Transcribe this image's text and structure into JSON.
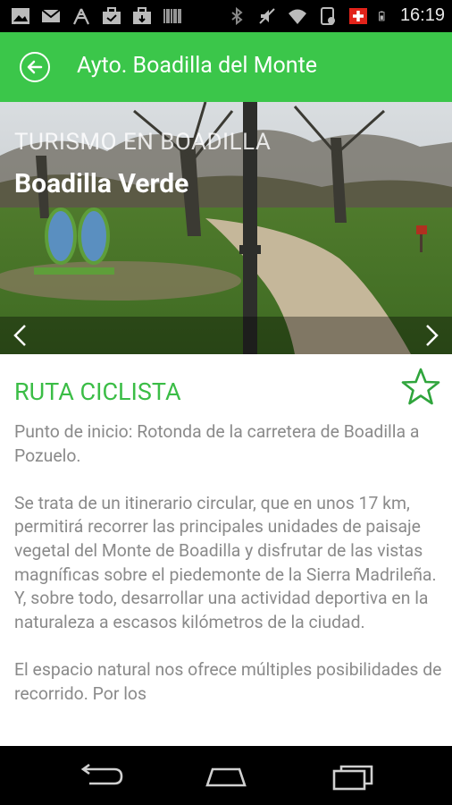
{
  "status_bar": {
    "time": "16:19",
    "left_icons": [
      "image-icon",
      "gmail-icon",
      "signal-tower-icon",
      "briefcase-icon",
      "briefcase-icon",
      "barcode-icon"
    ],
    "right_icons": [
      "bluetooth-icon",
      "mute-icon",
      "wifi-icon",
      "phone-icon",
      "swiss-flag-icon",
      "battery-icon"
    ]
  },
  "app_bar": {
    "title": "Ayto. Boadilla del Monte"
  },
  "hero": {
    "subtitle": "TURISMO EN BOADILLA",
    "title": "Boadilla Verde"
  },
  "content": {
    "section_title": "RUTA CICLISTA",
    "paragraphs": [
      "Punto de inicio: Rotonda de la carretera de Boadilla a Pozuelo.",
      "Se trata de un itinerario circular, que en unos 17 km, permitirá recorrer las principales unidades de paisaje vegetal del Monte de Boadilla y disfrutar de las vistas magníficas sobre el piedemonte de la Sierra Madrileña. Y, sobre todo, desarrollar una actividad deportiva en la naturaleza a escasos kilómetros de la ciudad.",
      "El espacio natural nos ofrece múltiples posibilidades de recorrido. Por los"
    ]
  },
  "colors": {
    "accent": "#3bc64a",
    "title_green": "#3bbd46",
    "body_text": "#8a8a8a"
  }
}
